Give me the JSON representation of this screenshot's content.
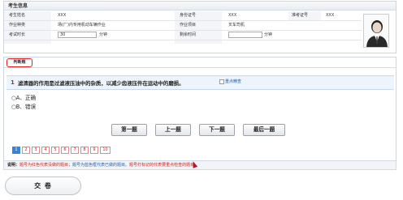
{
  "info": {
    "title": "考生信息",
    "name_label": "考生姓名",
    "name_value": "XXX",
    "id_label": "身份证号",
    "id_value": "XXX",
    "cert_label": "准考证号",
    "cert_value": "XXX",
    "category_label": "作业种类",
    "category_value": "场(厂)内专用机动车辆作业",
    "project_label": "作业项目",
    "project_value": "叉车司机",
    "duration_label": "考试时长",
    "duration_value": "30",
    "duration_unit": "分钟",
    "remaining_label": "剩余时间",
    "remaining_value": "",
    "remaining_unit": "分钟"
  },
  "section": {
    "title": "判断题",
    "question_number": "1",
    "question_text": "滤清器的作用是过滤液压油中的杂质，以减少齿液压件在运动中的磨损。",
    "pic_alt": "重点精查",
    "options": [
      "○A、正确",
      "○B、错误"
    ]
  },
  "nav": {
    "first": "第一题",
    "prev": "上一题",
    "next": "下一题",
    "last": "最后一题"
  },
  "pager": [
    "1",
    "2",
    "3",
    "4",
    "5",
    "6",
    "7",
    "8",
    "9",
    "10"
  ],
  "legend": {
    "prefix": "说明：",
    "red": "题号为红色代表没做的题目；",
    "blue": "题号为蓝色框代表已做的题目。",
    "rest": "题号打",
    "rest2": "标记的代表要重点检查的题目。"
  },
  "submit_label": "交 卷"
}
